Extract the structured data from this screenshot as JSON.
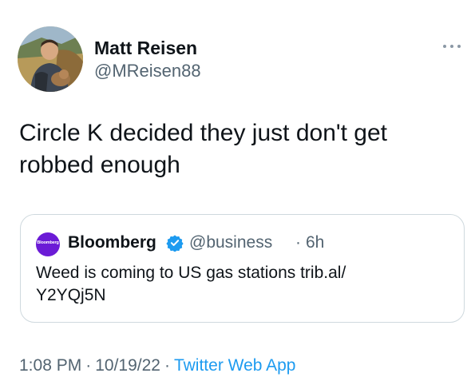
{
  "tweet": {
    "author": {
      "display_name": "Matt Reisen",
      "handle": "@MReisen88",
      "avatar": "profile-photo"
    },
    "more_icon": "ellipsis-icon",
    "text": "Circle K decided they just don't get\nrobbed enough",
    "quote": {
      "avatar_label": "Bloomberg",
      "display_name": "Bloomberg",
      "verified_icon": "verified-badge-icon",
      "handle": "@business",
      "separator": "·",
      "time": "6h",
      "text": "Weed is coming to US gas stations trib.al/\nY2YQj5N"
    },
    "footer": {
      "time": "1:08 PM",
      "separator": "·",
      "date": "10/19/22",
      "separator2": "·",
      "source": "Twitter Web App"
    }
  },
  "colors": {
    "text": "#0f1419",
    "secondary": "#536471",
    "link": "#1d9bf0",
    "border": "#cfd9de",
    "bloomberg_purple": "#6b1bd6"
  }
}
